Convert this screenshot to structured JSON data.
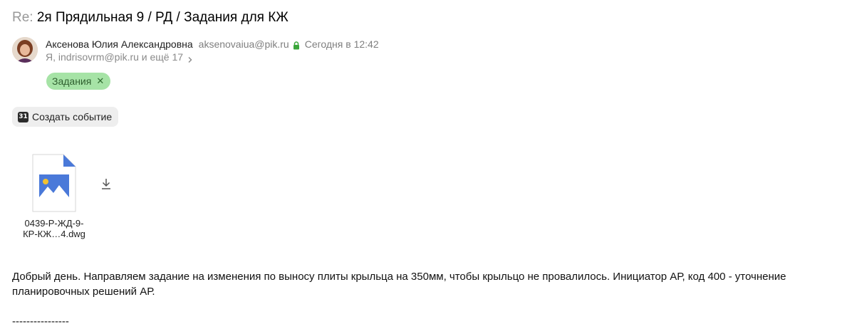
{
  "subject": {
    "prefix": "Re:",
    "title": "2я Прядильная 9 / РД / Задания для КЖ"
  },
  "sender": {
    "name": "Аксенова Юлия Александровна",
    "email": "aksenovaiua@pik.ru",
    "date": "Сегодня в 12:42",
    "recipients": "Я, indrisovrm@pik.ru и ещё 17"
  },
  "label": {
    "text": "Задания",
    "remove": "✕",
    "color": "#a6e3a6"
  },
  "actions": {
    "create_event": "Создать событие",
    "calendar_day": "31"
  },
  "attachment": {
    "name_line1": "0439-Р-ЖД-9-",
    "name_line2": "КР-КЖ…4.dwg",
    "icon": "image-file-icon",
    "accent": "#4a79d9"
  },
  "body": {
    "text": "Добрый день. Направляем задание на изменения по выносу плиты крыльца на 350мм, чтобы крыльцо не провалилось. Инициатор АР, код 400 - уточнение планировочных решений АР.",
    "separator": "----------------"
  }
}
